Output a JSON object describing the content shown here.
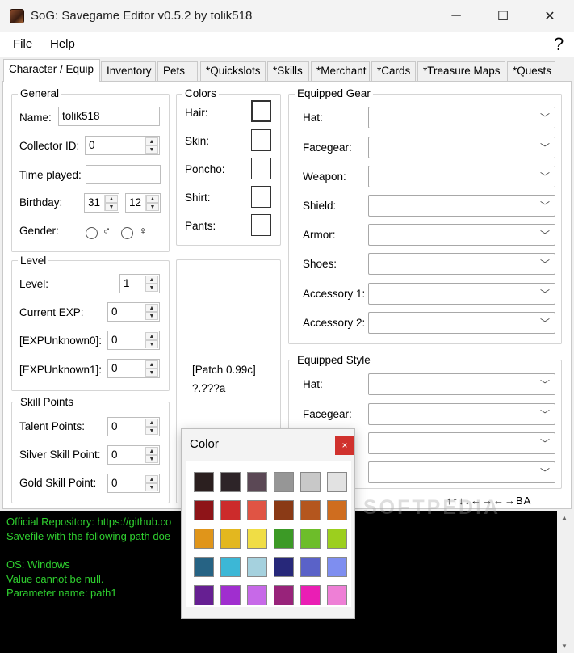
{
  "window": {
    "title": "SoG: Savegame Editor v0.5.2 by tolik518",
    "min": "─",
    "max": "☐",
    "close": "✕"
  },
  "menu": {
    "file": "File",
    "help": "Help",
    "help_icon": "?"
  },
  "tabs": [
    {
      "label": "Character / Equip"
    },
    {
      "label": "Inventory"
    },
    {
      "label": "Pets"
    },
    {
      "label": "*Quickslots"
    },
    {
      "label": "*Skills"
    },
    {
      "label": "*Merchant"
    },
    {
      "label": "*Cards"
    },
    {
      "label": "*Treasure Maps"
    },
    {
      "label": "*Quests"
    }
  ],
  "general": {
    "title": "General",
    "name_label": "Name:",
    "name_value": "tolik518",
    "collector_label": "Collector ID:",
    "collector_value": "0",
    "time_label": "Time played:",
    "time_value": "",
    "birthday_label": "Birthday:",
    "birthday_day": "31",
    "birthday_month": "12",
    "gender_label": "Gender:",
    "male_symbol": "♂",
    "female_symbol": "♀"
  },
  "colors": {
    "title": "Colors",
    "hair": "Hair:",
    "skin": "Skin:",
    "poncho": "Poncho:",
    "shirt": "Shirt:",
    "pants": "Pants:"
  },
  "level": {
    "title": "Level",
    "level_label": "Level:",
    "level_value": "1",
    "exp_label": "Current EXP:",
    "exp_value": "0",
    "u0_label": "[EXPUnknown0]:",
    "u0_value": "0",
    "u1_label": "[EXPUnknown1]:",
    "u1_value": "0"
  },
  "skill_points": {
    "title": "Skill Points",
    "talent_label": "Talent Points:",
    "talent_value": "0",
    "silver_label": "Silver Skill Point:",
    "silver_value": "0",
    "gold_label": "Gold Skill Point:",
    "gold_value": "0"
  },
  "patch": {
    "line1": "[Patch 0.99c]",
    "line2": "?.???a"
  },
  "equipped_gear": {
    "title": "Equipped Gear",
    "slots": [
      "Hat:",
      "Facegear:",
      "Weapon:",
      "Shield:",
      "Armor:",
      "Shoes:",
      "Accessory 1:",
      "Accessory 2:"
    ]
  },
  "equipped_style": {
    "title": "Equipped Style",
    "slots": [
      "Hat:",
      "Facegear:"
    ]
  },
  "konami": "↑↑↓↓←→←→BA",
  "console": [
    "Official Repository: https://github.co",
    "Savefile with the following path doe",
    "",
    "OS: Windows",
    "Value cannot be null.",
    "Parameter name: path1"
  ],
  "color_popup": {
    "title": "Color",
    "close": "×",
    "swatches": [
      "#2b1f1f",
      "#2d2428",
      "#5b4855",
      "#969696",
      "#c8c8c8",
      "#e2e2e2",
      "#8e1418",
      "#cc2b2b",
      "#e05444",
      "#8a3a16",
      "#b4561e",
      "#cf6d1f",
      "#e0951a",
      "#e3b71f",
      "#f0dd45",
      "#3c9a26",
      "#6dbd2a",
      "#9ccf1e",
      "#266384",
      "#3cb7d6",
      "#a5d1de",
      "#27287a",
      "#5a62c8",
      "#7e8ef0",
      "#661f92",
      "#a02ecf",
      "#c769e8",
      "#98237a",
      "#ea1eb4",
      "#ee7fd6"
    ]
  },
  "watermark": "SOFTPEDIA"
}
